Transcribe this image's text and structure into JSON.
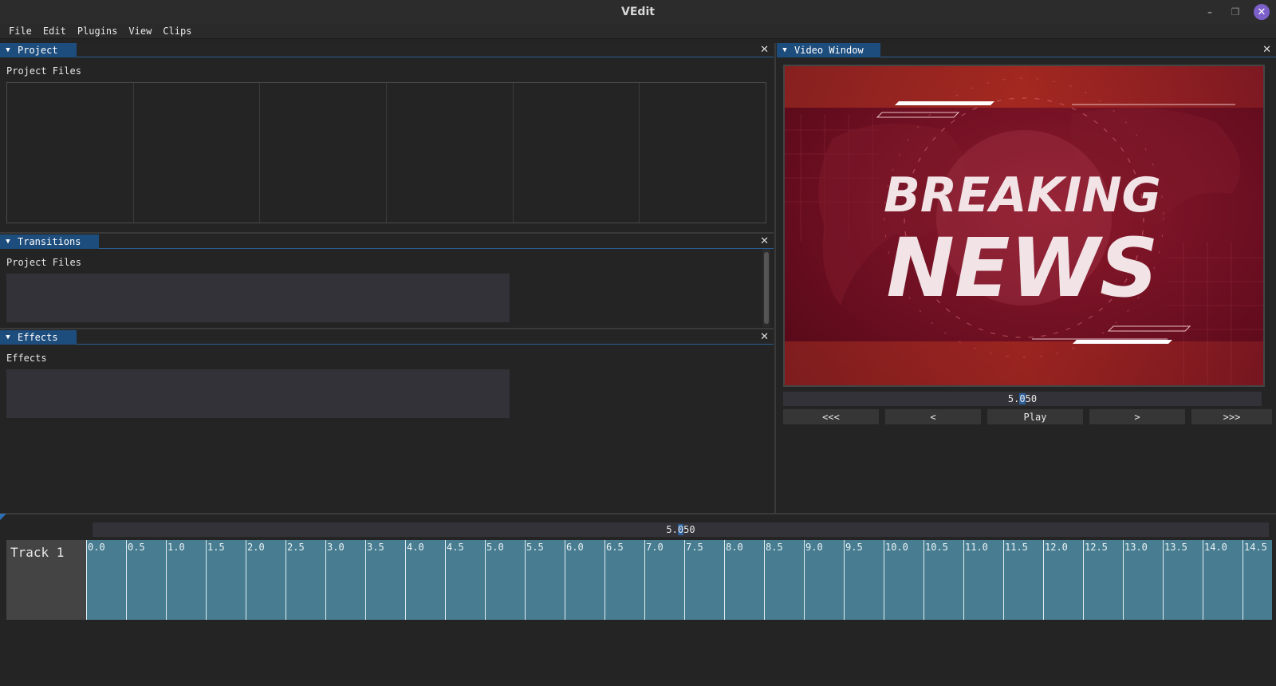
{
  "window": {
    "title": "VEdit",
    "minimize": "–",
    "maximize": "❐",
    "close": "✕"
  },
  "menu": [
    "File",
    "Edit",
    "Plugins",
    "View",
    "Clips"
  ],
  "panels": {
    "project": {
      "tab": "Project",
      "label": "Project Files",
      "columns": 6
    },
    "transitions": {
      "tab": "Transitions",
      "label": "Project Files"
    },
    "effects": {
      "tab": "Effects",
      "label": "Effects"
    },
    "video": {
      "tab": "Video Window"
    }
  },
  "video": {
    "headline_top": "BREAKING",
    "headline_bottom": "NEWS",
    "time_prefix": "5.",
    "time_cursor": "0",
    "time_suffix": "50",
    "controls": [
      "<<<",
      "<",
      "Play",
      ">",
      ">>>"
    ]
  },
  "timeline": {
    "time_prefix": "5.",
    "time_cursor": "0",
    "time_suffix": "50",
    "track_name": "Track 1",
    "ticks": [
      "0.0",
      "0.5",
      "1.0",
      "1.5",
      "2.0",
      "2.5",
      "3.0",
      "3.5",
      "4.0",
      "4.5",
      "5.0",
      "5.5",
      "6.0",
      "6.5",
      "7.0",
      "7.5",
      "8.0",
      "8.5",
      "9.0",
      "9.5",
      "10.0",
      "10.5",
      "11.0",
      "11.5",
      "12.0",
      "12.5",
      "13.0",
      "13.5",
      "14.0",
      "14.5"
    ]
  },
  "colors": {
    "accent": "#1d4d7d",
    "track": "#487d91",
    "news_red": "#7a1326"
  }
}
